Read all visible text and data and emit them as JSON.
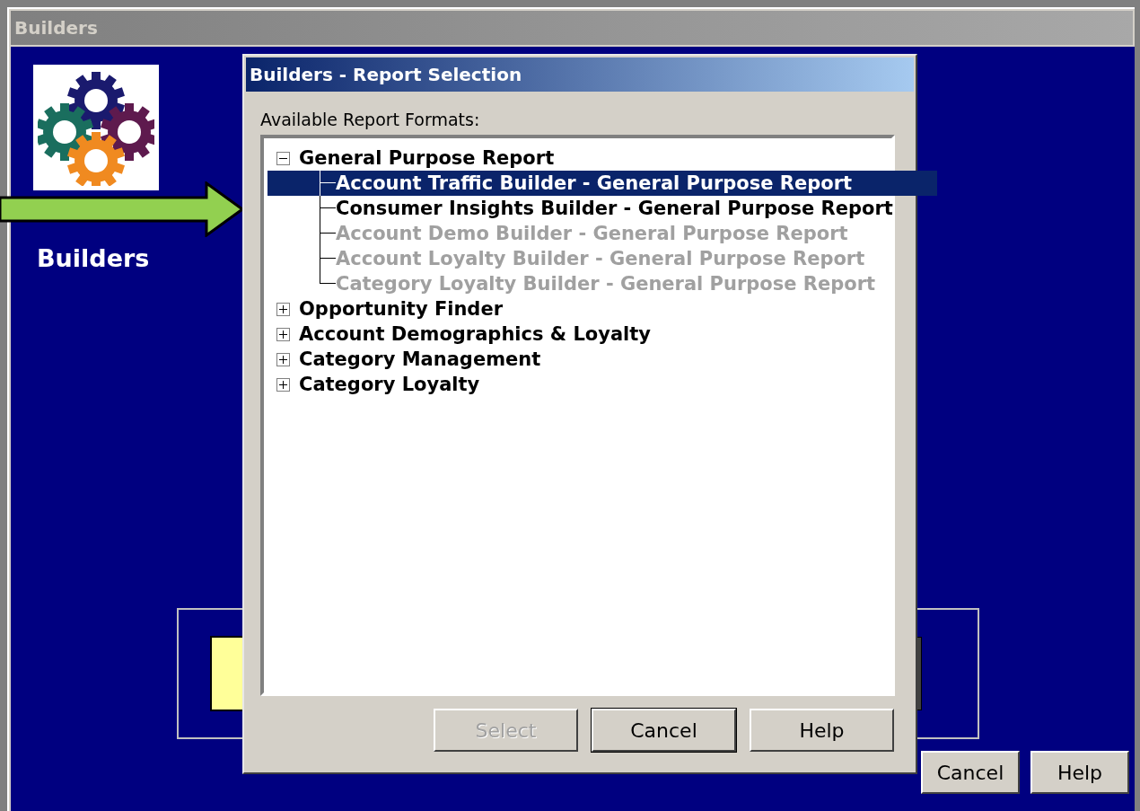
{
  "window": {
    "title": "Builders",
    "logo_caption": "Builders"
  },
  "dialog": {
    "title": "Builders - Report Selection",
    "list_label": "Available Report Formats:",
    "tree": [
      {
        "label": "General Purpose Report",
        "expanded": true,
        "children": [
          {
            "label": "Account Traffic Builder - General Purpose Report",
            "selected": true,
            "disabled": false
          },
          {
            "label": "Consumer Insights Builder - General Purpose Report",
            "selected": false,
            "disabled": false
          },
          {
            "label": "Account Demo Builder - General Purpose Report",
            "selected": false,
            "disabled": true
          },
          {
            "label": "Account Loyalty Builder - General Purpose Report",
            "selected": false,
            "disabled": true
          },
          {
            "label": "Category Loyalty Builder - General Purpose Report",
            "selected": false,
            "disabled": true
          }
        ]
      },
      {
        "label": "Opportunity Finder",
        "expanded": false
      },
      {
        "label": "Account Demographics & Loyalty",
        "expanded": false
      },
      {
        "label": "Category Management",
        "expanded": false
      },
      {
        "label": "Category Loyalty",
        "expanded": false
      }
    ],
    "buttons": [
      {
        "label": "Select",
        "disabled": true,
        "focused": false
      },
      {
        "label": "Cancel",
        "disabled": false,
        "focused": true
      },
      {
        "label": "Help",
        "disabled": false,
        "focused": false
      }
    ]
  },
  "footer_buttons": [
    {
      "label": "Cancel"
    },
    {
      "label": "Help"
    }
  ]
}
